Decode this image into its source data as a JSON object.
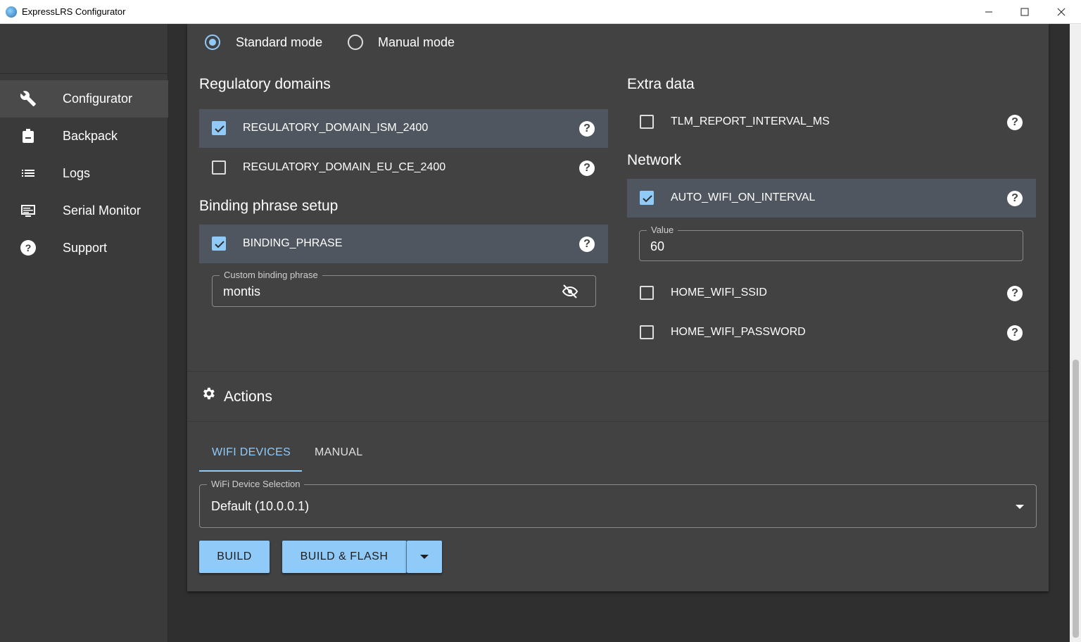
{
  "window": {
    "title": "ExpressLRS Configurator",
    "minimize": "—",
    "maximize": "☐",
    "close": "✕"
  },
  "sidebar": {
    "items": [
      {
        "label": "Configurator",
        "icon": "wrench-icon"
      },
      {
        "label": "Backpack",
        "icon": "backpack-icon"
      },
      {
        "label": "Logs",
        "icon": "list-icon"
      },
      {
        "label": "Serial Monitor",
        "icon": "monitor-icon"
      },
      {
        "label": "Support",
        "icon": "help-circle-icon"
      }
    ]
  },
  "mode": {
    "standard": "Standard mode",
    "manual": "Manual mode",
    "selected": "standard"
  },
  "regulatory": {
    "heading": "Regulatory domains",
    "options": [
      {
        "label": "REGULATORY_DOMAIN_ISM_2400",
        "checked": true
      },
      {
        "label": "REGULATORY_DOMAIN_EU_CE_2400",
        "checked": false
      }
    ]
  },
  "binding": {
    "heading": "Binding phrase setup",
    "option": {
      "label": "BINDING_PHRASE",
      "checked": true
    },
    "field_label": "Custom binding phrase",
    "field_value": "montis"
  },
  "extra": {
    "heading": "Extra data",
    "option": {
      "label": "TLM_REPORT_INTERVAL_MS",
      "checked": false
    }
  },
  "network": {
    "heading": "Network",
    "options": [
      {
        "label": "AUTO_WIFI_ON_INTERVAL",
        "checked": true
      },
      {
        "label": "HOME_WIFI_SSID",
        "checked": false
      },
      {
        "label": "HOME_WIFI_PASSWORD",
        "checked": false
      }
    ],
    "value_label": "Value",
    "value": "60"
  },
  "help_glyph": "?",
  "actions": {
    "heading": "Actions",
    "tabs": [
      {
        "label": "WIFI DEVICES",
        "active": true
      },
      {
        "label": "MANUAL",
        "active": false
      }
    ],
    "device_label": "WiFi Device Selection",
    "device_value": "Default (10.0.0.1)",
    "build": "BUILD",
    "build_flash": "BUILD & FLASH"
  },
  "colors": {
    "accent": "#90caf9",
    "panel": "#424242",
    "sidebar": "#3a3a3a",
    "background": "#2f2f2f"
  }
}
